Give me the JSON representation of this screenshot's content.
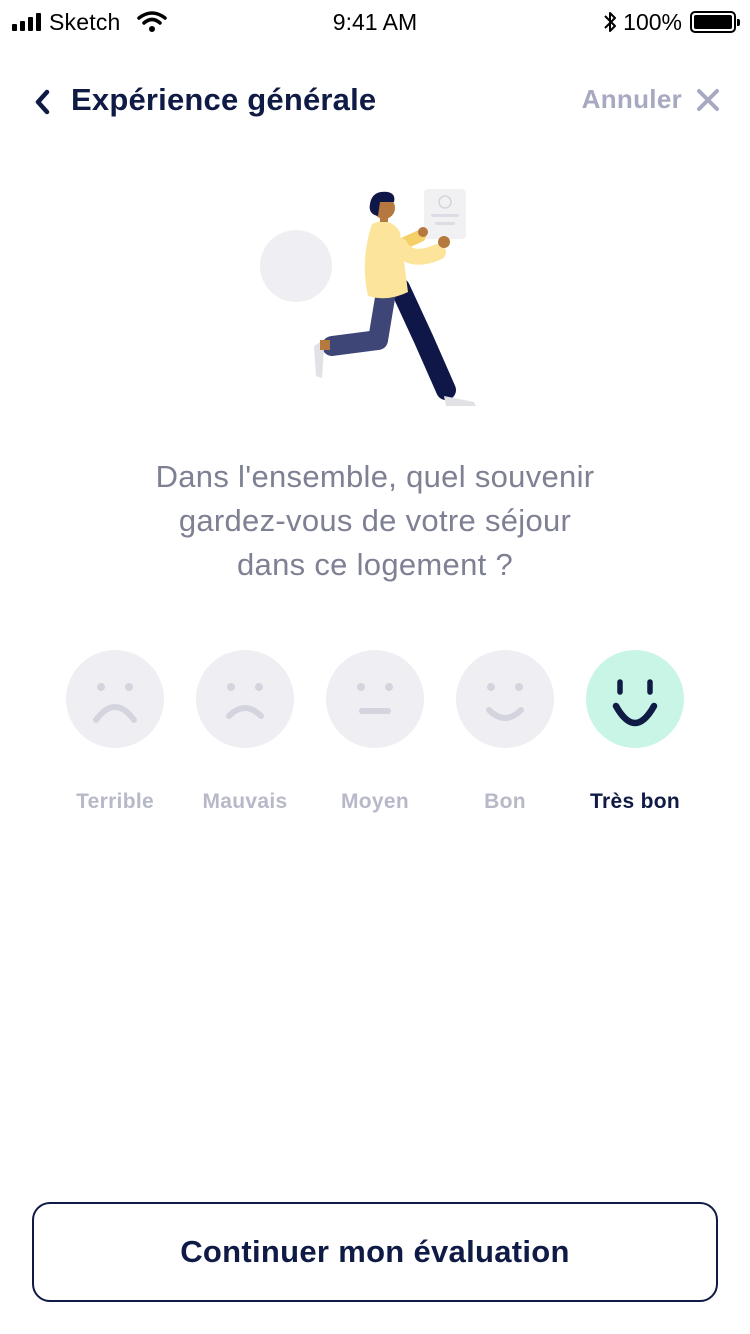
{
  "status_bar": {
    "carrier": "Sketch",
    "time": "9:41 AM",
    "battery": "100%"
  },
  "header": {
    "title": "Expérience générale",
    "cancel_label": "Annuler"
  },
  "question": {
    "line1": "Dans l'ensemble, quel souvenir",
    "line2": "gardez-vous de votre séjour",
    "line3": "dans ce logement ?"
  },
  "ratings": [
    {
      "label": "Terrible",
      "icon": "very-sad-face-icon",
      "selected": false
    },
    {
      "label": "Mauvais",
      "icon": "sad-face-icon",
      "selected": false
    },
    {
      "label": "Moyen",
      "icon": "neutral-face-icon",
      "selected": false
    },
    {
      "label": "Bon",
      "icon": "smile-face-icon",
      "selected": false
    },
    {
      "label": "Très bon",
      "icon": "big-smile-face-icon",
      "selected": true
    }
  ],
  "selected_rating": "Très bon",
  "continue_button": {
    "label": "Continuer mon évaluation"
  },
  "colors": {
    "primary": "#0f1a45",
    "muted_label": "#b7b9c8",
    "question_text": "#7e8093",
    "face_bg": "#efeff3",
    "selected_face_bg": "#c8f5e5"
  }
}
